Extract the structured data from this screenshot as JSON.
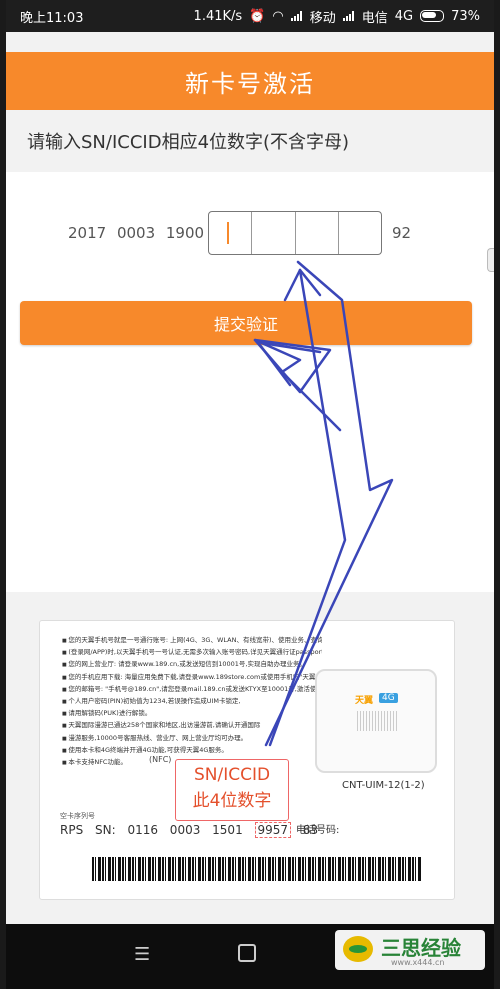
{
  "status_bar": {
    "time": "晚上11:03",
    "speed": "1.41K/s",
    "carrier1": "移动",
    "carrier2": "电信",
    "network": "4G",
    "battery": "73%"
  },
  "header": {
    "title": "新卡号激活"
  },
  "instruction": "请输入SN/ICCID相应4位数字(不含字母)",
  "input_row": {
    "prefix": "2017 0003 1900",
    "suffix": "92"
  },
  "submit_label": "提交验证",
  "card": {
    "lines": [
      "您的天翼手机号就是一号通行账号: 上网(4G、3G、WLAN、有线宽带)、使用业务、查询办理业务",
      "(登录网/APP)时,以天翼手机号一号认证,无需多次输入账号密码,详见天翼通行证passport.189.cn。",
      "您的网上营业厅: 请登录www.189.cn,或发送短信到10001号,实现自助办理业务。",
      "您的手机应用下载: 海量应用免费下载,请登录www.189store.com或使用手机内\"天翼空间\"客户端。",
      "您的邮箱号: \"手机号@189.cn\",请您登录mail.189.cn或发送KTYX至10001号,激活使用。",
      "个人用户密码(PIN)初始值为1234,若误操作造成UIM卡锁定,",
      "请用解锁码(PUK)进行解锁。",
      "天翼国际漫游已通达258个国家和地区,出访漫游前,请确认开通国际",
      "漫游服务,10000号客服热线、营业厅、网上营业厅均可办理。",
      "使用本卡和4G终端并开通4G功能,可获得天翼4G服务。",
      "本卡支持NFC功能。"
    ],
    "nfc": "(NFC)",
    "sim_brand": "天翼",
    "sim_4g": "4G",
    "sim_model": "CNT-UIM-12(1-2)",
    "callout_line1": "SN/ICCID",
    "callout_line2": "此4位数字",
    "rps_label": "空卡序列号",
    "rps_prefix": "RPS SN:  0116  0003  1501",
    "rps_highlight": "9957",
    "rps_suffix": "83",
    "phone_label": "电话号码:"
  },
  "navbar": {
    "menu_glyph": "☰"
  },
  "watermark": {
    "title": "三思经验",
    "url": "www.x444.cn"
  },
  "colors": {
    "accent": "#f7892b",
    "annotation": "#3a46b8",
    "callout": "#e4502c"
  }
}
